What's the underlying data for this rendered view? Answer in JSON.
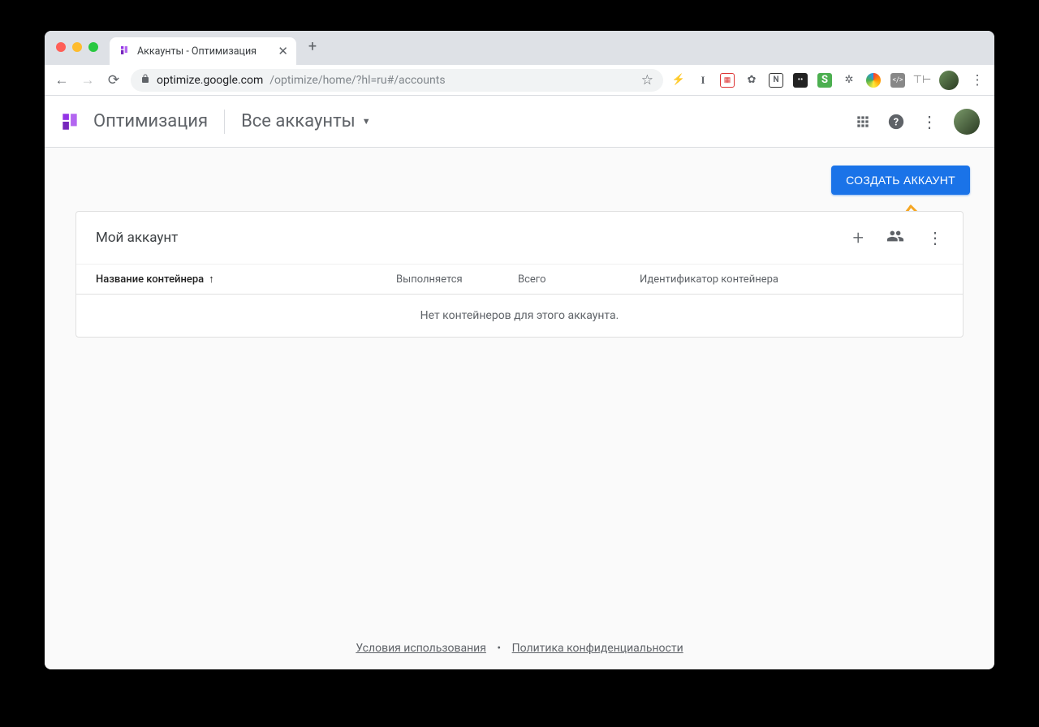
{
  "browser": {
    "tab_title": "Аккаунты - Оптимизация",
    "url_host": "optimize.google.com",
    "url_path": "/optimize/home/?hl=ru#/accounts"
  },
  "header": {
    "product": "Оптимизация",
    "account_switch": "Все аккаунты"
  },
  "page": {
    "create_button": "СОЗДАТЬ АККАУНТ",
    "account_name": "Мой аккаунт",
    "columns": {
      "name": "Название контейнера",
      "running": "Выполняется",
      "total": "Всего",
      "container_id": "Идентификатор контейнера"
    },
    "empty_message": "Нет контейнеров для этого аккаунта."
  },
  "footer": {
    "terms": "Условия использования",
    "privacy": "Политика конфиденциальности"
  }
}
